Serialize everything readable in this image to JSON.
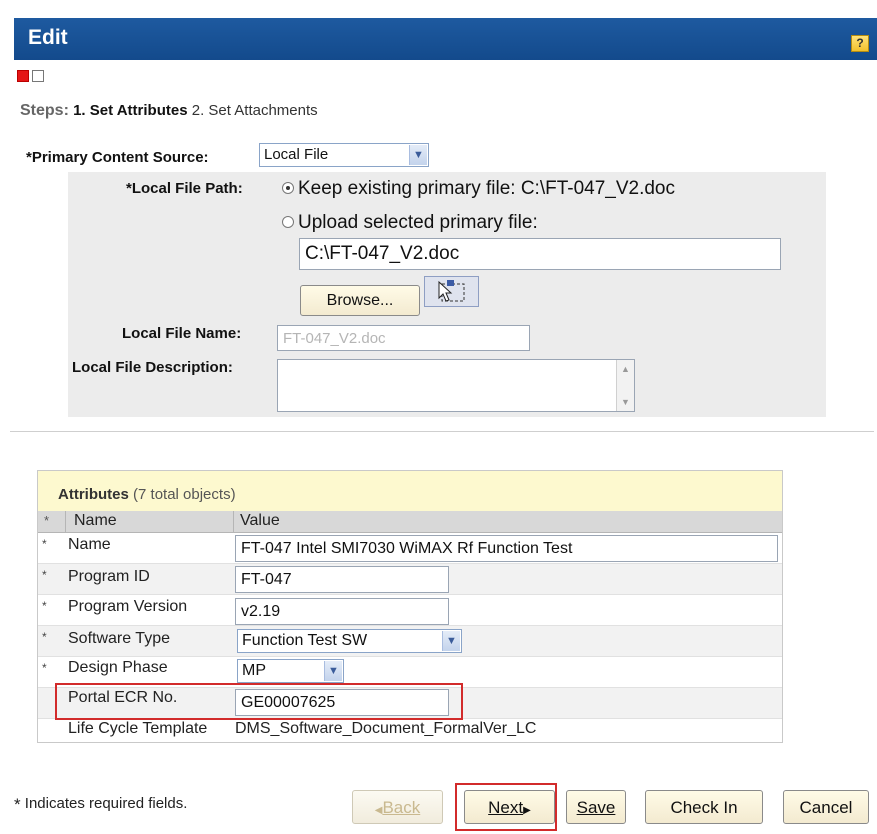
{
  "header": {
    "title": "Edit",
    "help": "?"
  },
  "steps": {
    "label": "Steps:",
    "step1_num": "1.",
    "step1_label": "Set Attributes",
    "step2_num": "2.",
    "step2_label": "Set Attachments"
  },
  "content_source": {
    "label": "*Primary Content Source:",
    "value": "Local File"
  },
  "local_file": {
    "path_label": "*Local File Path:",
    "keep_label": "Keep existing primary file: C:\\FT-047_V2.doc",
    "upload_label": "Upload selected primary file:",
    "path_value": "C:\\FT-047_V2.doc",
    "browse_label": "Browse...",
    "name_label": "Local File Name:",
    "name_value": "FT-047_V2.doc",
    "desc_label": "Local File Description:",
    "desc_value": ""
  },
  "attributes": {
    "title": "Attributes",
    "count": "(7 total objects)",
    "col_star": "*",
    "col_name": "Name",
    "col_value": "Value",
    "rows": [
      {
        "star": "*",
        "name": "Name",
        "value": "FT-047 Intel SMI7030 WiMAX Rf Function Test"
      },
      {
        "star": "*",
        "name": "Program ID",
        "value": "FT-047"
      },
      {
        "star": "*",
        "name": "Program Version",
        "value": "v2.19"
      },
      {
        "star": "*",
        "name": "Software Type",
        "value": "Function Test SW"
      },
      {
        "star": "*",
        "name": "Design Phase",
        "value": "MP"
      },
      {
        "star": "",
        "name": "Portal ECR No.",
        "value": "GE00007625"
      },
      {
        "star": "",
        "name": "Life Cycle Template",
        "value": "DMS_Software_Document_FormalVer_LC"
      }
    ]
  },
  "footer": {
    "required_star": "*",
    "required_note": "Indicates required fields.",
    "back_label": "Back",
    "next_label": "Next",
    "save_label": "Save",
    "checkin_label": "Check In",
    "cancel_label": "Cancel"
  },
  "colors": {
    "header_blue": "#134a8c",
    "highlight_red": "#d22b2b",
    "panel_yellow": "#fdf9cf"
  }
}
